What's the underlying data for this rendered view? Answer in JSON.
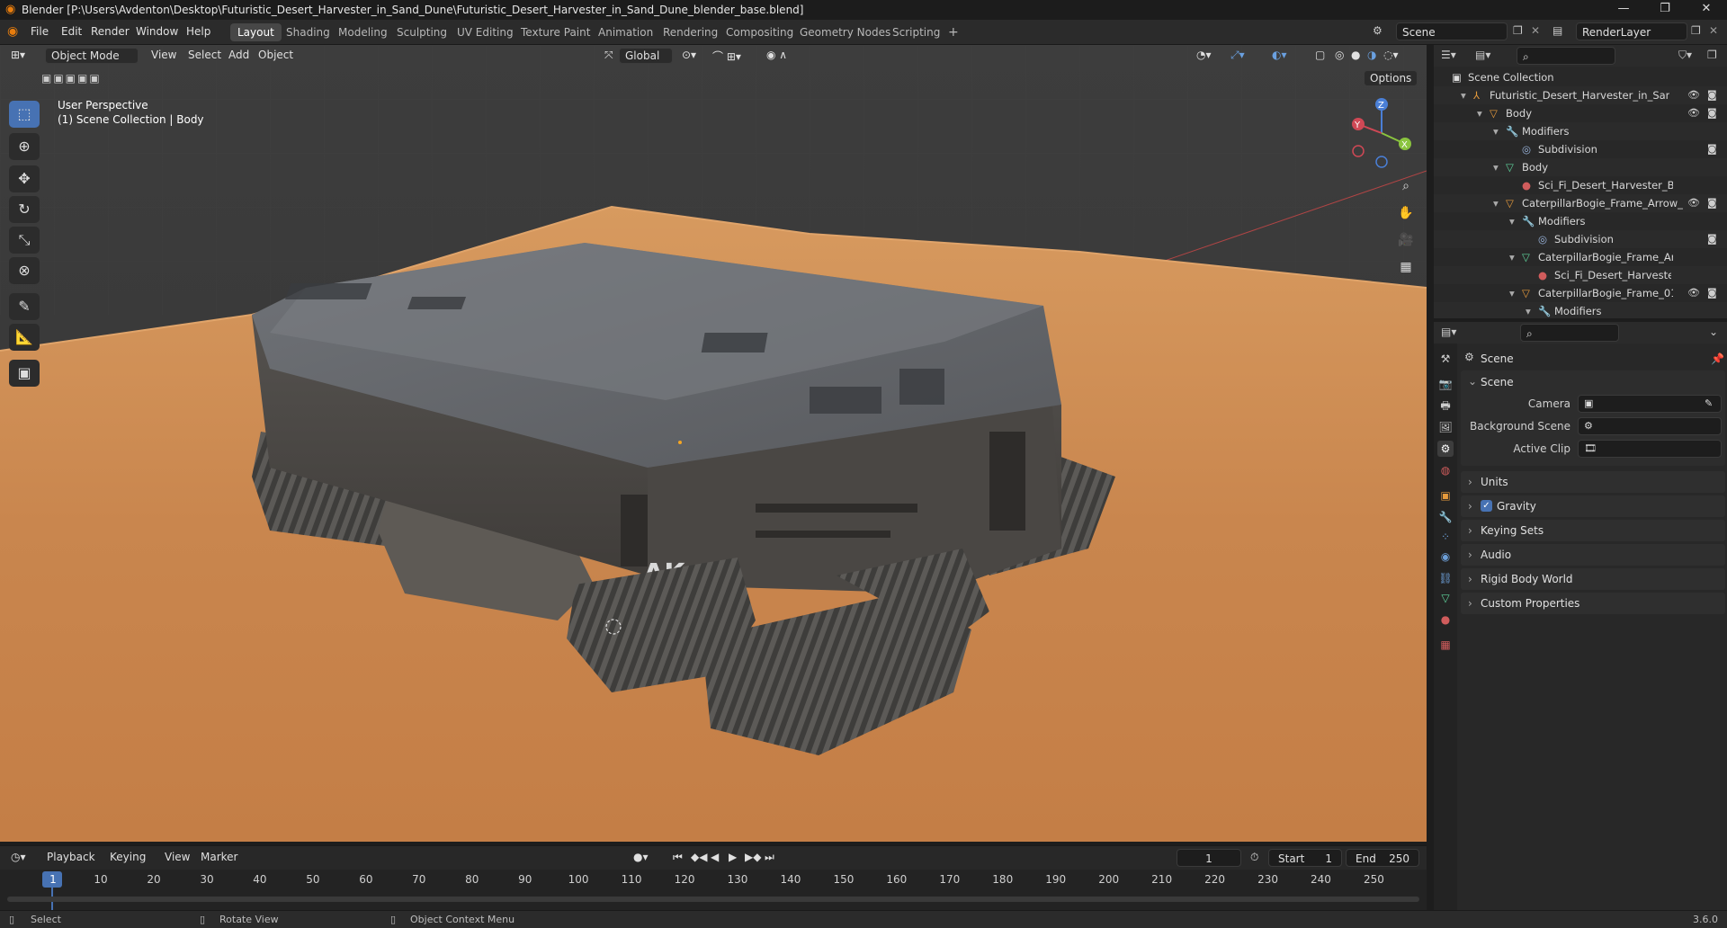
{
  "window": {
    "title": "Blender [P:\\Users\\Avdenton\\Desktop\\Futuristic_Desert_Harvester_in_Sand_Dune\\Futuristic_Desert_Harvester_in_Sand_Dune_blender_base.blend]",
    "minimize": "—",
    "maximize": "❐",
    "close": "✕"
  },
  "menubar": {
    "items": [
      "File",
      "Edit",
      "Render",
      "Window",
      "Help"
    ]
  },
  "workspaces": {
    "tabs": [
      "Layout",
      "Shading",
      "Modeling",
      "Sculpting",
      "UV Editing",
      "Texture Paint",
      "Animation",
      "Rendering",
      "Compositing",
      "Geometry Nodes",
      "Scripting"
    ],
    "active": "Layout",
    "add": "+"
  },
  "scene_selector": {
    "value": "Scene"
  },
  "view_layer_selector": {
    "value": "RenderLayer"
  },
  "viewport": {
    "mode": "Object Mode",
    "menus": [
      "View",
      "Select",
      "Add",
      "Object"
    ],
    "transform_orientation": "Global",
    "options_label": "Options",
    "perspective_label": "User Perspective",
    "collection_label": "(1) Scene Collection | Body",
    "gizmo": {
      "z": "Z",
      "y": "Y",
      "x": "X"
    },
    "hull_logo": "AK"
  },
  "outliner": {
    "search_placeholder": "",
    "rows": [
      {
        "label": "Scene Collection",
        "icon": "collection-icon"
      },
      {
        "label": "Futuristic_Desert_Harvester_in_Sand_Dune",
        "icon": "armature-icon"
      },
      {
        "label": "Body",
        "icon": "mesh-object-icon"
      },
      {
        "label": "Modifiers",
        "icon": "wrench-icon"
      },
      {
        "label": "Subdivision",
        "icon": "subdivision-icon"
      },
      {
        "label": "Body",
        "icon": "mesh-data-icon"
      },
      {
        "label": "Sci_Fi_Desert_Harvester_Body",
        "icon": "material-icon"
      },
      {
        "label": "CaterpillarBogie_Frame_Arrow_",
        "icon": "mesh-object-icon"
      },
      {
        "label": "Modifiers",
        "icon": "wrench-icon"
      },
      {
        "label": "Subdivision",
        "icon": "subdivision-icon"
      },
      {
        "label": "CaterpillarBogie_Frame_Arr",
        "icon": "mesh-data-icon"
      },
      {
        "label": "Sci_Fi_Desert_Harveste",
        "icon": "material-icon"
      },
      {
        "label": "CaterpillarBogie_Frame_01",
        "icon": "mesh-object-icon"
      },
      {
        "label": "Modifiers",
        "icon": "wrench-icon"
      }
    ]
  },
  "properties": {
    "context_title": "Scene",
    "scene_panel": "Scene",
    "fields": [
      {
        "label": "Camera"
      },
      {
        "label": "Background Scene"
      },
      {
        "label": "Active Clip"
      }
    ],
    "panels": [
      "Units",
      "Gravity",
      "Keying Sets",
      "Audio",
      "Rigid Body World",
      "Custom Properties"
    ],
    "gravity_checked": true
  },
  "timeline": {
    "menus": [
      "Playback",
      "Keying",
      "View",
      "Marker"
    ],
    "current_frame": "1",
    "start_label": "Start",
    "start_value": "1",
    "end_label": "End",
    "end_value": "250",
    "ruler": [
      "1",
      "10",
      "20",
      "30",
      "40",
      "50",
      "60",
      "70",
      "80",
      "90",
      "100",
      "110",
      "120",
      "130",
      "140",
      "150",
      "160",
      "170",
      "180",
      "190",
      "200",
      "210",
      "220",
      "230",
      "240",
      "250"
    ]
  },
  "statusbar": {
    "select": "Select",
    "rotate": "Rotate View",
    "context_menu": "Object Context Menu",
    "version": "3.6.0"
  },
  "colors": {
    "accent": "#4772b3",
    "sand": "#c9864e",
    "hull": "#5b5b5d"
  }
}
